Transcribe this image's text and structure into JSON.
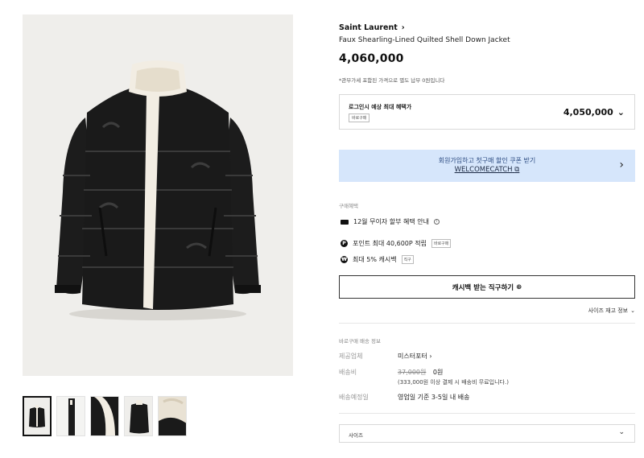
{
  "product": {
    "brand": "Saint Laurent",
    "brand_chevron": "›",
    "name": "Faux Shearling-Lined Quilted Shell Down Jacket",
    "price": "4,060,000",
    "tax_note": "*관부가세 포함된 가격으로 별도 납부 0원입니다"
  },
  "login_price": {
    "label": "로그인시 예상 최대 혜택가",
    "tag": "바로구매",
    "amount": "4,050,000",
    "chevron": "⌄"
  },
  "promo": {
    "line1": "회원가입하고 첫구매 할인 쿠폰 받기",
    "code": "WELCOMECATCH",
    "copy_icon": "⧉",
    "arrow": "›"
  },
  "benefits": {
    "section_label": "구매혜택",
    "items": [
      {
        "icon": "card-icon",
        "text": "12월 무이자 할부 혜택 안내",
        "tag": ""
      },
      {
        "icon": "point-icon",
        "icon_glyph": "P",
        "text": "포인트 최대 40,600P 적립",
        "tag": "바로구매"
      },
      {
        "icon": "cashback-icon",
        "icon_glyph": "₩",
        "text": "최대 5% 캐시백",
        "tag": "직구"
      }
    ]
  },
  "cashback_button": {
    "label": "캐시백 받는 직구하기",
    "icon": "⊕"
  },
  "size_stock": {
    "label": "사이즈 재고 정보",
    "chevron": "⌄"
  },
  "shipping": {
    "section_label": "바로구매 배송 정보",
    "provider_key": "제공업체",
    "provider_value": "미스터포터",
    "provider_chevron": "›",
    "fee_key": "배송비",
    "fee_original": "37,000원",
    "fee_value": "0원",
    "fee_note": "(333,000원 이상 결제 시 배송비 무료입니다.)",
    "eta_key": "배송예정일",
    "eta_value": "영업일 기준 3-5일 내 배송"
  },
  "size_select": {
    "label": "사이즈",
    "chevron": "⌄"
  },
  "colors": {
    "promo_bg": "#d6e6fb",
    "jacket": "#1a1a1a",
    "shearling": "#f2ede3"
  }
}
